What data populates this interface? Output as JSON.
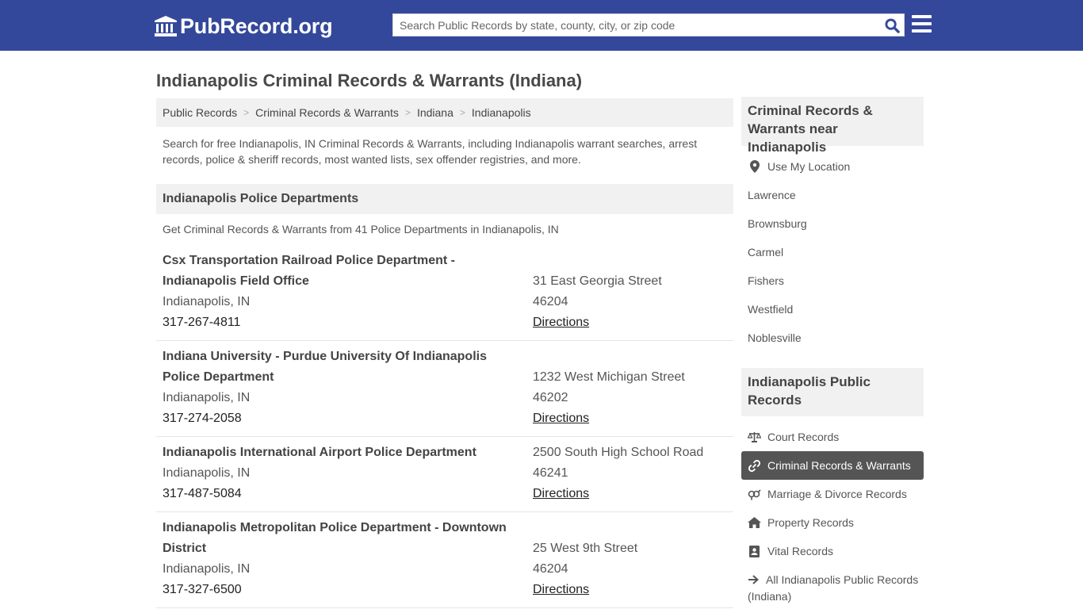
{
  "header": {
    "logo_text": "PubRecord.org",
    "search_placeholder": "Search Public Records by state, county, city, or zip code"
  },
  "page_title": "Indianapolis Criminal Records & Warrants (Indiana)",
  "breadcrumb": [
    "Public Records",
    "Criminal Records & Warrants",
    "Indiana",
    "Indianapolis"
  ],
  "breadcrumb_separator": ">",
  "intro": "Search for free Indianapolis, IN Criminal Records & Warrants, including Indianapolis warrant searches, arrest records, police & sheriff records, most wanted lists, sex offender registries, and more.",
  "section": {
    "title": "Indianapolis Police Departments",
    "subtitle": "Get Criminal Records & Warrants from 41 Police Departments in Indianapolis, IN"
  },
  "listings": [
    {
      "name": "Csx Transportation Railroad Police Department - Indianapolis Field Office",
      "city": "Indianapolis, IN",
      "phone": "317-267-4811",
      "address": "31 East Georgia Street",
      "zip": "46204",
      "directions": "Directions"
    },
    {
      "name": "Indiana University - Purdue University Of Indianapolis Police Department",
      "city": "Indianapolis, IN",
      "phone": "317-274-2058",
      "address": "1232 West Michigan Street",
      "zip": "46202",
      "directions": "Directions"
    },
    {
      "name": "Indianapolis International Airport Police Department",
      "city": "Indianapolis, IN",
      "phone": "317-487-5084",
      "address": "2500 South High School Road",
      "zip": "46241",
      "directions": "Directions"
    },
    {
      "name": "Indianapolis Metropolitan Police Department - Downtown District",
      "city": "Indianapolis, IN",
      "phone": "317-327-6500",
      "address": "25 West 9th Street",
      "zip": "46204",
      "directions": "Directions"
    }
  ],
  "sidebar": {
    "nearby_title": "Criminal Records & Warrants near Indianapolis",
    "use_location": "Use My Location",
    "nearby": [
      "Lawrence",
      "Brownsburg",
      "Carmel",
      "Fishers",
      "Westfield",
      "Noblesville"
    ],
    "records_title": "Indianapolis Public Records",
    "records": [
      {
        "label": "Court Records",
        "icon": "scale-icon"
      },
      {
        "label": "Criminal Records & Warrants",
        "icon": "link-icon"
      },
      {
        "label": "Marriage & Divorce Records",
        "icon": "gender-icon"
      },
      {
        "label": "Property Records",
        "icon": "home-icon"
      },
      {
        "label": "Vital Records",
        "icon": "id-card-icon"
      }
    ],
    "all_records": "All Indianapolis Public Records (Indiana)"
  },
  "colors": {
    "header_bg": "#34489b",
    "search_icon": "#34489b",
    "active_bg": "#555555"
  }
}
